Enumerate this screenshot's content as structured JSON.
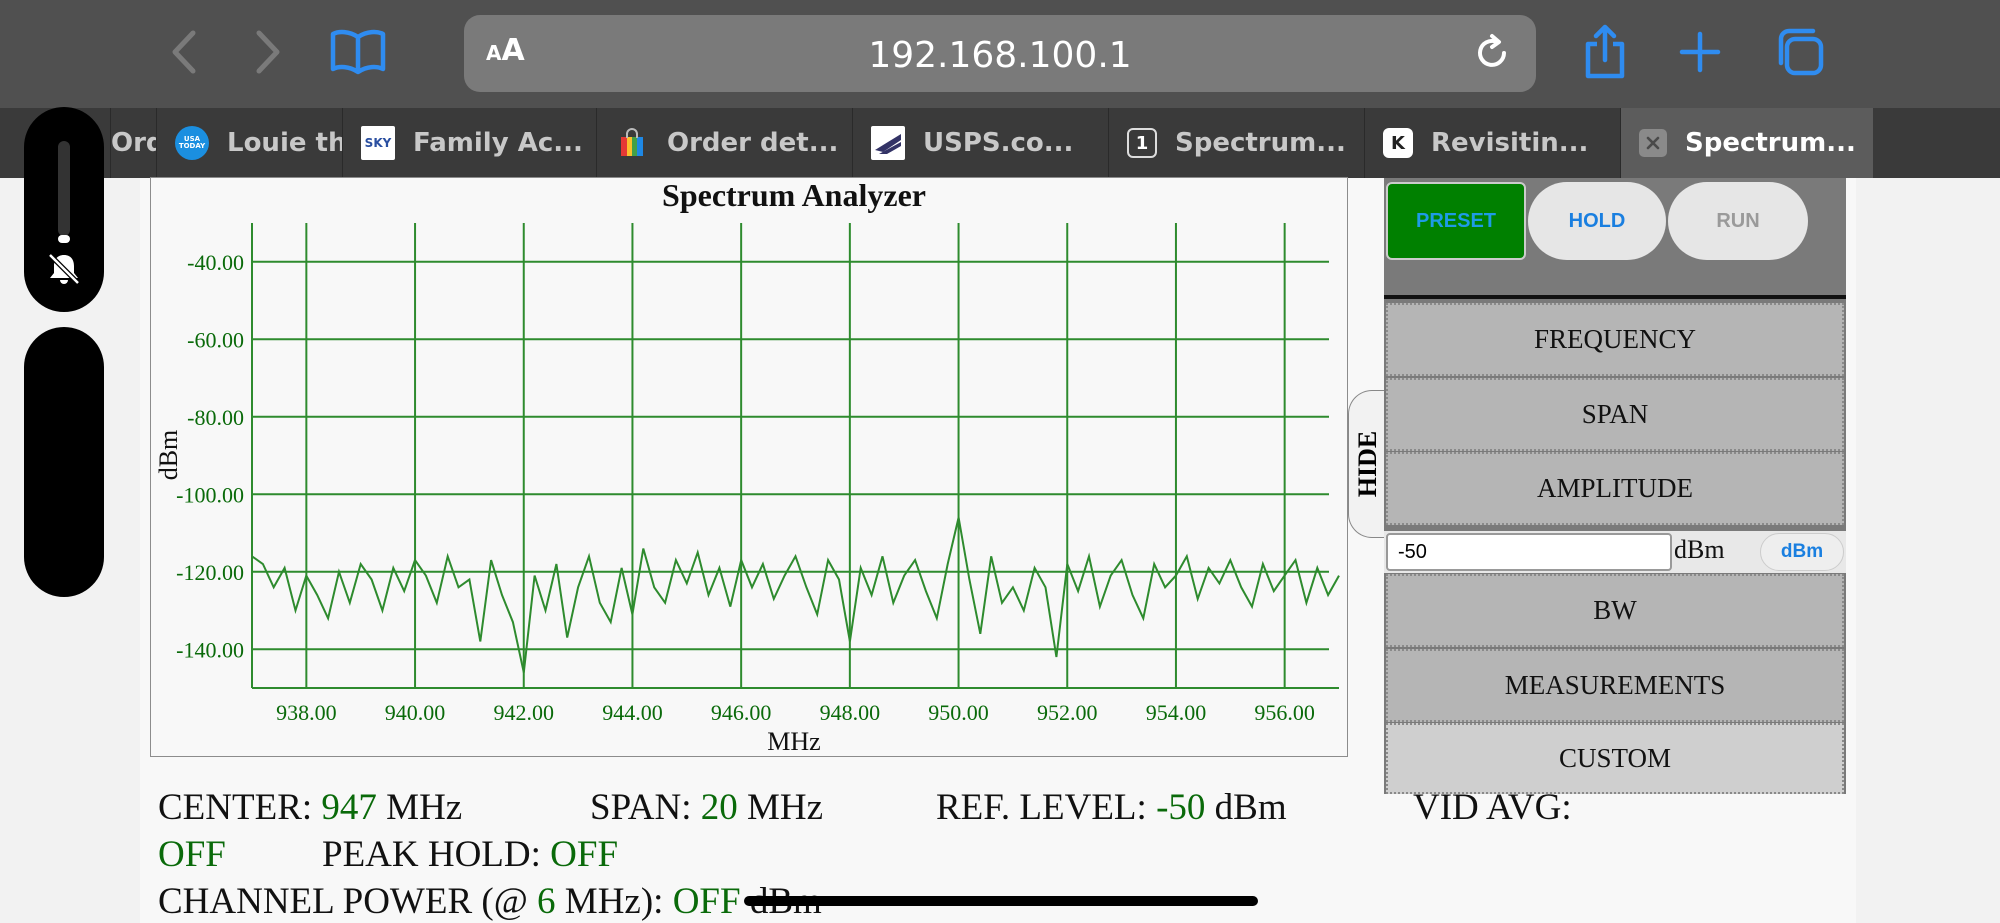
{
  "browser": {
    "url": "192.168.100.1",
    "text_size_label": "AA",
    "tabs": [
      {
        "title": "Ord",
        "favicon": "none"
      },
      {
        "title": "Louie th",
        "favicon": "usa-today-icon",
        "favicon_text": "USA TODAY"
      },
      {
        "title": "Family Ac...",
        "favicon": "sky-icon",
        "favicon_text": "SKY"
      },
      {
        "title": "Order det...",
        "favicon": "shopping-bag-icon"
      },
      {
        "title": "USPS.co...",
        "favicon": "usps-eagle-icon"
      },
      {
        "title": "Spectrum...",
        "favicon": "number-1-icon",
        "favicon_text": "1"
      },
      {
        "title": "Revisitin...",
        "favicon": "letter-k-icon",
        "favicon_text": "K"
      },
      {
        "title": "Spectrum...",
        "favicon": "close-icon",
        "active": true
      }
    ]
  },
  "analyzer": {
    "title": "Spectrum Analyzer",
    "buttons": {
      "preset": "PRESET",
      "hold": "HOLD",
      "run": "RUN"
    },
    "menu": {
      "frequency": "FREQUENCY",
      "span": "SPAN",
      "amplitude": "AMPLITUDE",
      "bw": "BW",
      "measurements": "MEASUREMENTS",
      "custom": "CUSTOM"
    },
    "amplitude_input": {
      "value": "-50",
      "unit_label": "dBm",
      "unit_button": "dBm"
    },
    "hide_label": "HIDE",
    "colors": {
      "preset_bg": "#008000",
      "trace": "#2e8b2e",
      "grid": "#2e8b2e",
      "value_text": "#0a6a0a"
    }
  },
  "status": {
    "center_label": "CENTER:",
    "center_value": "947",
    "center_unit": "MHz",
    "span_label": "SPAN:",
    "span_value": "20",
    "span_unit": "MHz",
    "ref_label": "REF. LEVEL:",
    "ref_value": "-50",
    "ref_unit": "dBm",
    "vidavg_label": "VID AVG:",
    "vidavg_value": "OFF",
    "peak_label": "PEAK HOLD:",
    "peak_value": "OFF",
    "chpow_label": "CHANNEL POWER (@",
    "chpow_bw": "6",
    "chpow_mid": "MHz):",
    "chpow_value": "OFF",
    "chpow_unit": "dBm"
  },
  "chart_data": {
    "type": "line",
    "title": "Spectrum Analyzer",
    "xlabel": "MHz",
    "ylabel": "dBm",
    "xlim": [
      937,
      957
    ],
    "ylim": [
      -150,
      -30
    ],
    "x_ticks": [
      "938.00",
      "940.00",
      "942.00",
      "944.00",
      "946.00",
      "948.00",
      "950.00",
      "952.00",
      "954.00",
      "956.00"
    ],
    "y_ticks": [
      "-40.00",
      "-60.00",
      "-80.00",
      "-100.00",
      "-120.00",
      "-140.00"
    ],
    "grid": true,
    "series": [
      {
        "x": [
          937.0,
          937.2,
          937.4,
          937.6,
          937.8,
          938.0,
          938.2,
          938.4,
          938.6,
          938.8,
          939.0,
          939.2,
          939.4,
          939.6,
          939.8,
          940.0,
          940.2,
          940.4,
          940.6,
          940.8,
          941.0,
          941.2,
          941.4,
          941.6,
          941.8,
          942.0,
          942.2,
          942.4,
          942.6,
          942.8,
          943.0,
          943.2,
          943.4,
          943.6,
          943.8,
          944.0,
          944.2,
          944.4,
          944.6,
          944.8,
          945.0,
          945.2,
          945.4,
          945.6,
          945.8,
          946.0,
          946.2,
          946.4,
          946.6,
          946.8,
          947.0,
          947.2,
          947.4,
          947.6,
          947.8,
          948.0,
          948.2,
          948.4,
          948.6,
          948.8,
          949.0,
          949.2,
          949.4,
          949.6,
          949.8,
          950.0,
          950.2,
          950.4,
          950.6,
          950.8,
          951.0,
          951.2,
          951.4,
          951.6,
          951.8,
          952.0,
          952.2,
          952.4,
          952.6,
          952.8,
          953.0,
          953.2,
          953.4,
          953.6,
          953.8,
          954.0,
          954.2,
          954.4,
          954.6,
          954.8,
          955.0,
          955.2,
          955.4,
          955.6,
          955.8,
          956.0,
          956.2,
          956.4,
          956.6,
          956.8,
          957.0
        ],
        "y": [
          -116,
          -118,
          -124,
          -119,
          -130,
          -121,
          -126,
          -132,
          -120,
          -128,
          -118,
          -122,
          -130,
          -119,
          -125,
          -117,
          -121,
          -128,
          -116,
          -124,
          -122,
          -138,
          -117,
          -126,
          -133,
          -146,
          -121,
          -130,
          -118,
          -137,
          -124,
          -116,
          -128,
          -133,
          -119,
          -131,
          -114,
          -124,
          -128,
          -117,
          -123,
          -115,
          -126,
          -119,
          -129,
          -117,
          -124,
          -118,
          -127,
          -121,
          -116,
          -124,
          -131,
          -117,
          -122,
          -138,
          -119,
          -126,
          -116,
          -128,
          -121,
          -117,
          -125,
          -132,
          -118,
          -106,
          -122,
          -136,
          -116,
          -128,
          -124,
          -130,
          -119,
          -124,
          -142,
          -118,
          -125,
          -116,
          -129,
          -121,
          -117,
          -126,
          -132,
          -118,
          -124,
          -121,
          -116,
          -127,
          -119,
          -123,
          -117,
          -124,
          -129,
          -118,
          -125,
          -121,
          -117,
          -128,
          -119,
          -126,
          -121
        ]
      }
    ]
  }
}
